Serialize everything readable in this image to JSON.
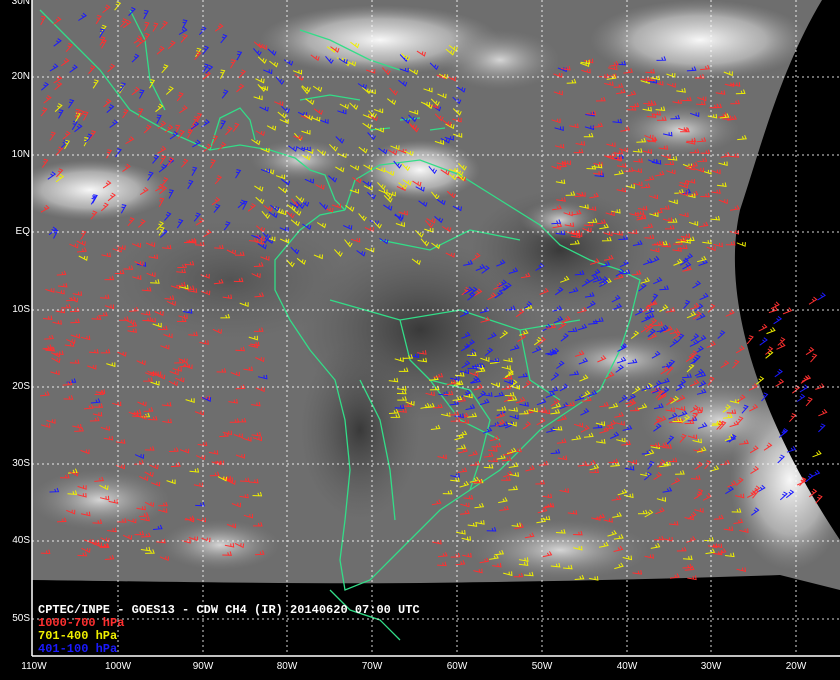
{
  "map": {
    "caption": "CPTEC/INPE - GOES13 - CDW CH4 (IR) 20140620 07:00 UTC",
    "legend": [
      {
        "label": "1000-700 hPa",
        "color": "#ff3030"
      },
      {
        "label": "701-400 hPa",
        "color": "#f0f000"
      },
      {
        "label": "401-100 hPa",
        "color": "#1a1aff"
      }
    ],
    "lat_labels": [
      "30N",
      "20N",
      "10N",
      "EQ",
      "10S",
      "20S",
      "30S",
      "40S",
      "50S"
    ],
    "lon_labels": [
      "110W",
      "100W",
      "90W",
      "80W",
      "70W",
      "60W",
      "50W",
      "40W",
      "30W",
      "20W"
    ],
    "colors": {
      "background": "#000000",
      "coastline": "#33dd88",
      "grid": "#ffffff"
    }
  }
}
